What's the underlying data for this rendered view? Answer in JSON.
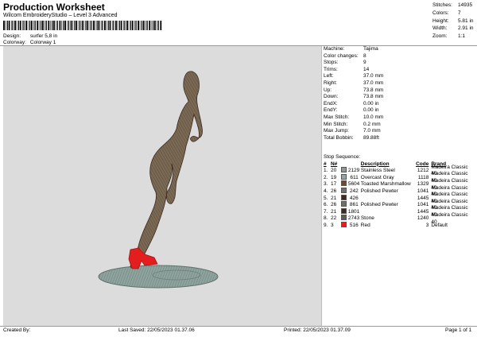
{
  "header": {
    "title": "Production Worksheet",
    "subtitle": "Wilcom EmbroideryStudio – Level 3 Advanced",
    "design_label": "Design:",
    "design_value": "surfer 5,8 in",
    "colorway_label": "Colorway:",
    "colorway_value": "Colorway 1"
  },
  "summary": [
    {
      "label": "Stitches:",
      "value": "14935"
    },
    {
      "label": "Colors:",
      "value": "7"
    },
    {
      "label": "Height:",
      "value": "5.81 in"
    },
    {
      "label": "Width:",
      "value": "2.91 in"
    },
    {
      "label": "Zoom:",
      "value": "1:1"
    }
  ],
  "machine_info": [
    {
      "label": "Machine:",
      "value": "Tajima"
    },
    {
      "label": "Color changes:",
      "value": "8"
    },
    {
      "label": "Stops:",
      "value": "9"
    },
    {
      "label": "Trims:",
      "value": "14"
    },
    {
      "label": "Left:",
      "value": "37.0 mm"
    },
    {
      "label": "Right:",
      "value": "37.0 mm"
    },
    {
      "label": "Up:",
      "value": "73.8 mm"
    },
    {
      "label": "Down:",
      "value": "73.8 mm"
    },
    {
      "label": "EndX:",
      "value": "0.00 in"
    },
    {
      "label": "EndY:",
      "value": "0.00 in"
    },
    {
      "label": "Max Stitch:",
      "value": "10.0 mm"
    },
    {
      "label": "Min Stitch:",
      "value": "0.2 mm"
    },
    {
      "label": "Max Jump:",
      "value": "7.0 mm"
    },
    {
      "label": "Total Bobbin:",
      "value": "89.88ft"
    }
  ],
  "stop_sequence": {
    "label": "Stop Sequence:",
    "headers": {
      "num": "#",
      "n": "N#",
      "st": "",
      "desc": "Description",
      "code": "Code",
      "brand": "Brand"
    },
    "rows": [
      {
        "num": "1.",
        "n": "20",
        "color": "#8f9794",
        "st": "2129",
        "desc": "Stainless Steel",
        "code": "1212",
        "brand": "Madeira Classic 40"
      },
      {
        "num": "2.",
        "n": "19",
        "color": "#9aa3a6",
        "st": "611",
        "desc": "Overcast Gray",
        "code": "1118",
        "brand": "Madeira Classic 40"
      },
      {
        "num": "3.",
        "n": "17",
        "color": "#6b4b33",
        "st": "5604",
        "desc": "Toasted Marshmallow",
        "code": "1329",
        "brand": "Madeira Classic 40"
      },
      {
        "num": "4.",
        "n": "26",
        "color": "#6f706a",
        "st": "242",
        "desc": "Polished Pewter",
        "code": "1041",
        "brand": "Madeira Classic 40"
      },
      {
        "num": "5.",
        "n": "21",
        "color": "#3d2a21",
        "st": "426",
        "desc": "",
        "code": "1445",
        "brand": "Madeira Classic 40"
      },
      {
        "num": "6.",
        "n": "26",
        "color": "#6f706a",
        "st": "861",
        "desc": "Polished Pewter",
        "code": "1041",
        "brand": "Madeira Classic 40"
      },
      {
        "num": "7.",
        "n": "21",
        "color": "#3d2a21",
        "st": "1801",
        "desc": "",
        "code": "1445",
        "brand": "Madeira Classic 40"
      },
      {
        "num": "8.",
        "n": "22",
        "color": "#5e5c58",
        "st": "2743",
        "desc": "Stone",
        "code": "1240",
        "brand": "Madeira Classic 40"
      },
      {
        "num": "9.",
        "n": "3",
        "color": "#e41e1e",
        "st": "516",
        "desc": "Red",
        "code": "3",
        "brand": "Default"
      }
    ]
  },
  "footer": {
    "created_by": "Created By:",
    "last_saved": "Last Saved: 22/05/2023 01.37.06",
    "printed": "Printed: 22/05/2023 01.37.09",
    "page": "Page 1 of 1"
  }
}
